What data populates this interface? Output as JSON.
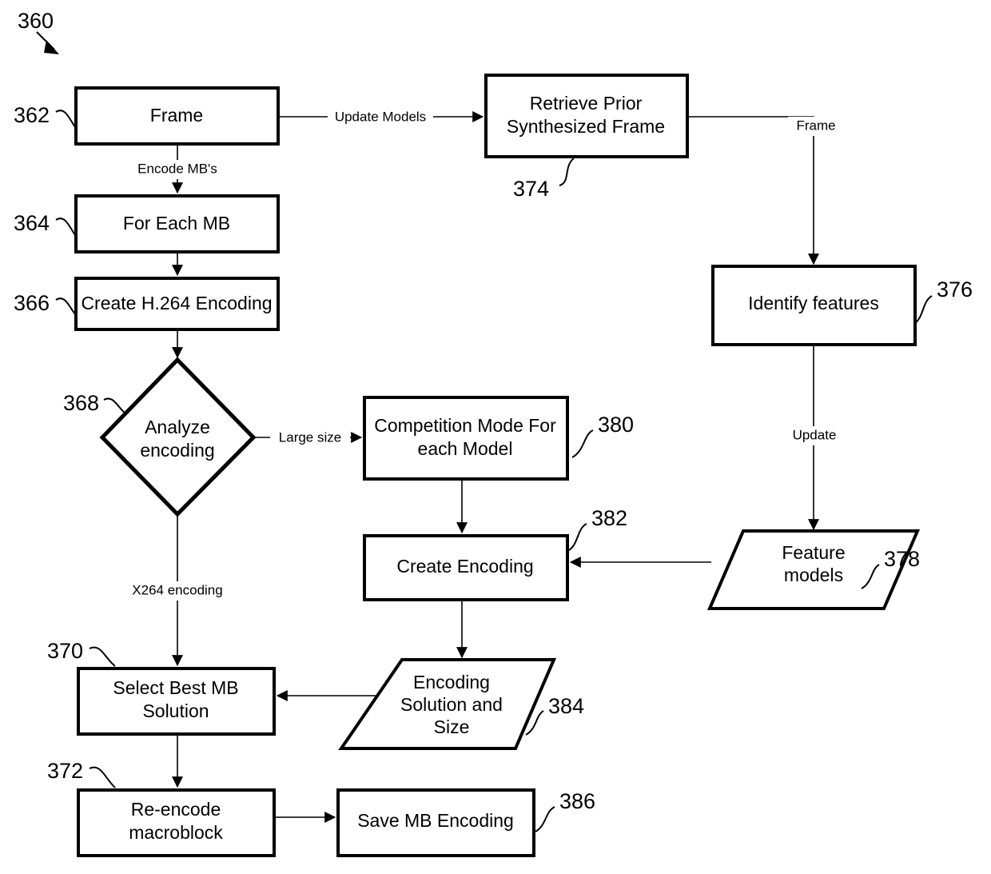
{
  "figure": {
    "figure_ref": "360"
  },
  "nodes": [
    {
      "id": "frame",
      "ref": "362",
      "label_lines": [
        "Frame"
      ],
      "shape": "process"
    },
    {
      "id": "for_each_mb",
      "ref": "364",
      "label_lines": [
        "For Each MB"
      ],
      "shape": "process"
    },
    {
      "id": "create_h264",
      "ref": "366",
      "label_lines": [
        "Create H.264 Encoding"
      ],
      "shape": "process"
    },
    {
      "id": "analyze",
      "ref": "368",
      "label_lines": [
        "Analyze",
        "encoding"
      ],
      "shape": "decision"
    },
    {
      "id": "select_best",
      "ref": "370",
      "label_lines": [
        "Select Best MB",
        "Solution"
      ],
      "shape": "process"
    },
    {
      "id": "reencode",
      "ref": "372",
      "label_lines": [
        "Re-encode",
        "macroblock"
      ],
      "shape": "process"
    },
    {
      "id": "retrieve",
      "ref": "374",
      "label_lines": [
        "Retrieve Prior",
        "Synthesized Frame"
      ],
      "shape": "process"
    },
    {
      "id": "identify",
      "ref": "376",
      "label_lines": [
        "Identify features"
      ],
      "shape": "process"
    },
    {
      "id": "feat_models",
      "ref": "378",
      "label_lines": [
        "Feature",
        "models"
      ],
      "shape": "data"
    },
    {
      "id": "competition",
      "ref": "380",
      "label_lines": [
        "Competition Mode For",
        "each Model"
      ],
      "shape": "process"
    },
    {
      "id": "create_enc",
      "ref": "382",
      "label_lines": [
        "Create Encoding"
      ],
      "shape": "process"
    },
    {
      "id": "enc_solution",
      "ref": "384",
      "label_lines": [
        "Encoding",
        "Solution and",
        "Size"
      ],
      "shape": "data"
    },
    {
      "id": "save_mb",
      "ref": "386",
      "label_lines": [
        "Save MB Encoding"
      ],
      "shape": "process"
    }
  ],
  "edges": [
    {
      "id": "frame-to-retrieve",
      "from": "frame",
      "to": "retrieve",
      "label": "Update Models"
    },
    {
      "id": "frame-to-foreach",
      "from": "frame",
      "to": "for_each_mb",
      "label": "Encode MB's"
    },
    {
      "id": "foreach-to-createh264",
      "from": "for_each_mb",
      "to": "create_h264",
      "label": ""
    },
    {
      "id": "createh264-to-analyze",
      "from": "create_h264",
      "to": "analyze",
      "label": ""
    },
    {
      "id": "analyze-to-competition",
      "from": "analyze",
      "to": "competition",
      "label": "Large size"
    },
    {
      "id": "analyze-to-selectbest",
      "from": "analyze",
      "to": "select_best",
      "label": "X264 encoding"
    },
    {
      "id": "retrieve-to-identify",
      "from": "retrieve",
      "to": "identify",
      "label": "Frame"
    },
    {
      "id": "identify-to-featmodels",
      "from": "identify",
      "to": "feat_models",
      "label": "Update"
    },
    {
      "id": "featmodels-to-createenc",
      "from": "feat_models",
      "to": "create_enc",
      "label": ""
    },
    {
      "id": "competition-to-createenc",
      "from": "competition",
      "to": "create_enc",
      "label": ""
    },
    {
      "id": "createenc-to-encsolution",
      "from": "create_enc",
      "to": "enc_solution",
      "label": ""
    },
    {
      "id": "encsolution-to-selectbest",
      "from": "enc_solution",
      "to": "select_best",
      "label": ""
    },
    {
      "id": "selectbest-to-reencode",
      "from": "select_best",
      "to": "reencode",
      "label": ""
    },
    {
      "id": "reencode-to-savemb",
      "from": "reencode",
      "to": "save_mb",
      "label": ""
    }
  ],
  "colors": {
    "stroke": "#000000",
    "fill": "#ffffff"
  }
}
